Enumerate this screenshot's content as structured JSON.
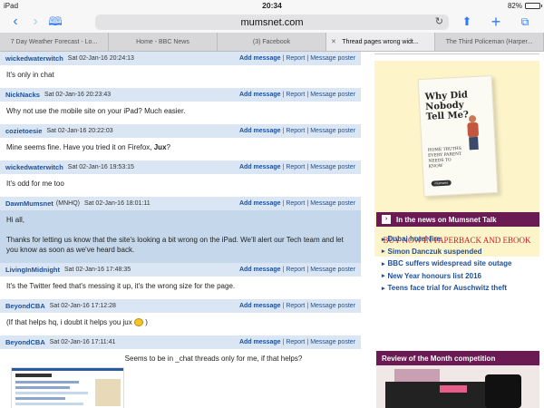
{
  "status_bar": {
    "carrier": "iPad",
    "time": "20:34",
    "battery": "82%",
    "battery_level": 0.82
  },
  "nav": {
    "url": "mumsnet.com"
  },
  "tabs": [
    {
      "label": "7 Day Weather Forecast - Lo..."
    },
    {
      "label": "Home - BBC News"
    },
    {
      "label": "(3) Facebook"
    },
    {
      "label": "Thread pages wrong widt...",
      "active": true
    },
    {
      "label": "The Third Policeman (Harper..."
    }
  ],
  "post_actions": {
    "add": "Add message",
    "report": "Report",
    "message_poster": "Message poster"
  },
  "messages": [
    {
      "poster": "wickedwaterwitch",
      "tag": "",
      "date": "Sat 02-Jan-16 20:24:13",
      "body": "It's only in chat"
    },
    {
      "poster": "NickNacks",
      "tag": "",
      "date": "Sat 02-Jan-16 20:23:43",
      "body": "Why not use the mobile site on your iPad? Much easier."
    },
    {
      "poster": "cozietoesie",
      "tag": "",
      "date": "Sat 02-Jan-16 20:22:03",
      "body": "Mine seems fine. Have you tried it on Firefox, ",
      "body_bold": "Jux",
      "body_end": "?"
    },
    {
      "poster": "wickedwaterwitch",
      "tag": "",
      "date": "Sat 02-Jan-16 19:53:15",
      "body": "It's odd for me too"
    },
    {
      "poster": "DawnMumsnet",
      "tag": "(MNHQ)",
      "date": "Sat 02-Jan-16 18:01:11",
      "body": "Hi all,",
      "body2": "Thanks for letting us know that the site's looking a bit wrong on the iPad. We'll alert our Tech team and let you know as soon as we've heard back."
    },
    {
      "poster": "LivingInMidnight",
      "tag": "",
      "date": "Sat 02-Jan-16 17:48:35",
      "body": "It's the Twitter feed that's messing it up, it's the wrong size for the page."
    },
    {
      "poster": "BeyondCBA",
      "tag": "",
      "date": "Sat 02-Jan-16 17:12:28",
      "body": "(If that helps hq, i doubt it helps you jux ",
      "body_end": " )"
    },
    {
      "poster": "BeyondCBA",
      "tag": "",
      "date": "Sat 02-Jan-16 17:11:41",
      "body": "Seems to be in _chat threads only for me, if that helps?"
    }
  ],
  "sidebar": {
    "book": {
      "title": "Why Did Nobody Tell Me?",
      "subtitle": "HOME TRUTHS EVERY PARENT NEEDS TO KNOW",
      "brand": "mumsnet"
    },
    "ad_cta": "BUY NOW IN PAPERBACK AND EBOOK",
    "news_title": "In the news on Mumsnet Talk",
    "news": [
      "Dubai hotel fire",
      "Simon Danczuk suspended",
      "BBC suffers widespread site outage",
      "New Year honours list 2016",
      "Teens face trial for Auschwitz theft"
    ],
    "review_title": "Review of the Month competition"
  },
  "colors": {
    "header_bg": "#dae6f3",
    "link": "#1f4f96",
    "accent_purple": "#6b1a54",
    "ad_bg": "#fdf4c9",
    "cta_red": "#c8202b"
  }
}
